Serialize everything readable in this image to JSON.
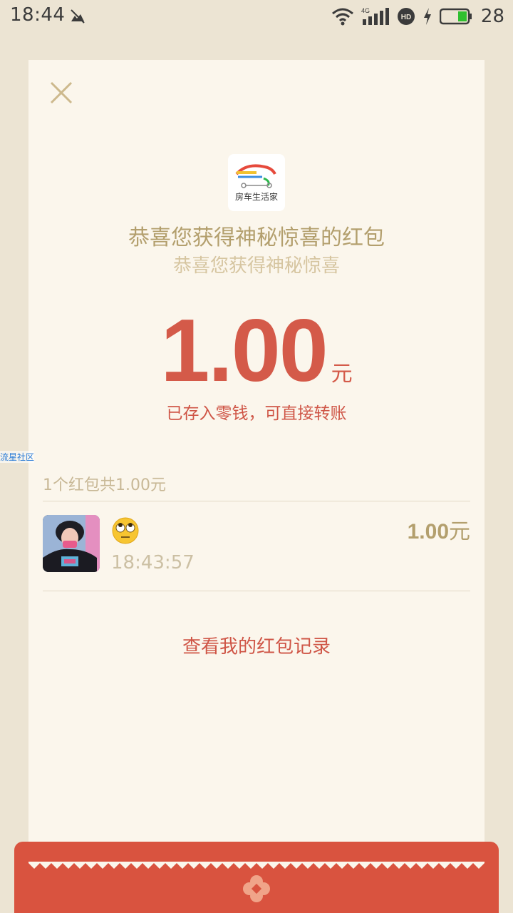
{
  "status_bar": {
    "time": "18:44",
    "network": "4G",
    "battery": "28"
  },
  "card": {
    "close_icon": "close-icon",
    "app_logo_text": "房车生活家",
    "title": "恭喜您获得神秘惊喜的红包",
    "subtitle": "恭喜您获得神秘惊喜",
    "amount": "1.00",
    "amount_unit": "元",
    "saved_note": "已存入零钱，可直接转账",
    "side_tag": "流星社区",
    "count_line": "1个红包共1.00元",
    "record": {
      "emoji": "rolling-eyes-emoji",
      "time": "18:43:57",
      "amount": "1.00",
      "unit": "元"
    },
    "history_link": "查看我的红包记录"
  },
  "colors": {
    "page_bg": "#ece4d3",
    "card_bg": "#fbf6ec",
    "accent_red": "#d45a49",
    "gold": "#b39f6d",
    "envelope_red": "#d9533f"
  }
}
